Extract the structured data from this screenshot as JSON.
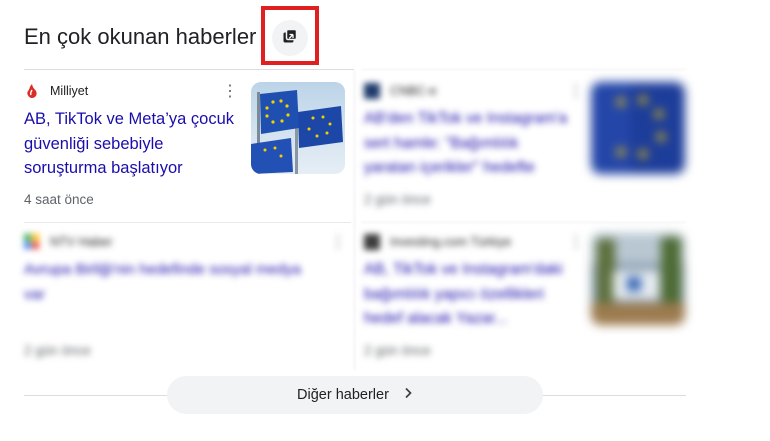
{
  "section": {
    "title": "En çok okunan haberler",
    "action_icon": "open-in-collection-icon"
  },
  "cards": [
    {
      "source": "Milliyet",
      "title_lines": [
        "AB, TikTok ve Meta’ya çocuk",
        "güvenliği sebebiyle",
        "soruşturma başlatıyor"
      ],
      "age": "4 saat önce",
      "thumbnail": "eu-flags-image"
    },
    {
      "source": "CNBC-e",
      "title_lines": [
        "AB'den TikTok ve Instagram'a",
        "sert hamle: \"Bağımlılık",
        "yaratan içerikler\" hedefte"
      ],
      "age": "2 gün önce",
      "thumbnail": "eu-flag-image"
    },
    {
      "source": "NTV Haber",
      "title_lines": [
        "Avrupa Birliği'nin hedefinde sosyal medya",
        "var"
      ],
      "age": "2 gün önce"
    },
    {
      "source": "Investing.com Türkiye",
      "title_lines": [
        "AB, TikTok ve Instagram'daki",
        "bağımlılık yapıcı özellikleri",
        "hedef alacak Yazar..."
      ],
      "age": "2 gün önce",
      "thumbnail": "building-image"
    }
  ],
  "more_button": {
    "label": "Diğer haberler",
    "icon": "chevron-right-icon"
  },
  "colors": {
    "link": "#1a0dab",
    "highlight": "#e02020",
    "pill_bg": "#f1f3f4"
  }
}
